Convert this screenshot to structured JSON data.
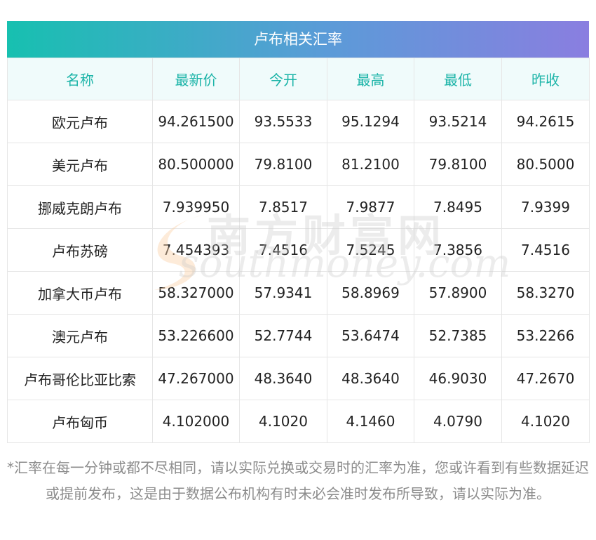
{
  "table_title": "卢布相关汇率",
  "headers": [
    "名称",
    "最新价",
    "今开",
    "最高",
    "最低",
    "昨收"
  ],
  "rows": [
    [
      "欧元卢布",
      "94.261500",
      "93.5533",
      "95.1294",
      "93.5214",
      "94.2615"
    ],
    [
      "美元卢布",
      "80.500000",
      "79.8100",
      "81.2100",
      "79.8100",
      "80.5000"
    ],
    [
      "挪威克朗卢布",
      "7.939950",
      "7.8517",
      "7.9877",
      "7.8495",
      "7.9399"
    ],
    [
      "卢布苏磅",
      "7.454393",
      "7.4516",
      "7.5245",
      "7.3856",
      "7.4516"
    ],
    [
      "加拿大币卢布",
      "58.327000",
      "57.9341",
      "58.8969",
      "57.8900",
      "58.3270"
    ],
    [
      "澳元卢布",
      "53.226600",
      "52.7744",
      "53.6474",
      "52.7385",
      "53.2266"
    ],
    [
      "卢布哥伦比亚比索",
      "47.267000",
      "48.3640",
      "48.3640",
      "46.9030",
      "47.2670"
    ],
    [
      "卢布匈币",
      "4.102000",
      "4.1020",
      "4.1460",
      "4.0790",
      "4.1020"
    ]
  ],
  "note": "*汇率在每一分钟或都不尽相同，请以实际兑换或交易时的汇率为准，您或许看到有些数据延迟或提前发布，这是由于数据公布机构有时未必会准时发布所导致，请以实际为准。",
  "watermark": {
    "cn": "南方财富网",
    "en": "southmoney.com"
  }
}
